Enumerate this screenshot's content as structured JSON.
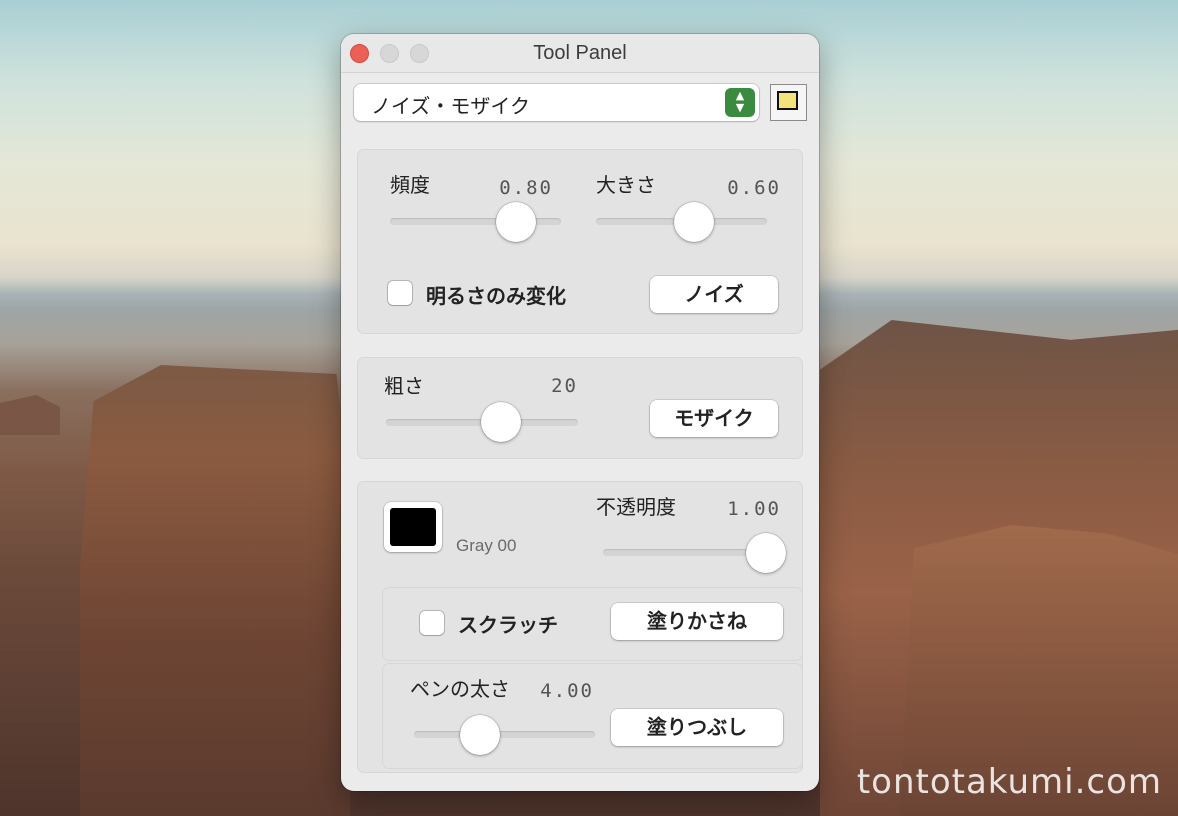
{
  "window": {
    "title": "Tool Panel"
  },
  "popup": {
    "selected": "ノイズ・モザイク",
    "stepper_color": "#3a8a3f"
  },
  "layer_button": {
    "icon": "overlapping-squares-icon"
  },
  "noise_group": {
    "frequency": {
      "label": "頻度",
      "value": "0.80",
      "level": 0.8
    },
    "size": {
      "label": "大きさ",
      "value": "0.60",
      "level": 0.6
    },
    "brightness_only": {
      "label": "明るさのみ変化",
      "checked": false
    },
    "noise_button": "ノイズ"
  },
  "mosaic_group": {
    "coarseness": {
      "label": "粗さ",
      "value": "20"
    },
    "mosaic_button": "モザイク"
  },
  "paint_group": {
    "color": {
      "name": "Gray 00",
      "hex": "#000000"
    },
    "opacity": {
      "label": "不透明度",
      "value": "1.00",
      "level": 1.0
    },
    "scratch": {
      "label": "スクラッチ",
      "checked": false
    },
    "overpaint_button": "塗りかさね",
    "pen_width": {
      "label": "ペンの太さ",
      "value": "4.00"
    },
    "fill_button": "塗りつぶし"
  },
  "watermark": "tontotakumi.com"
}
